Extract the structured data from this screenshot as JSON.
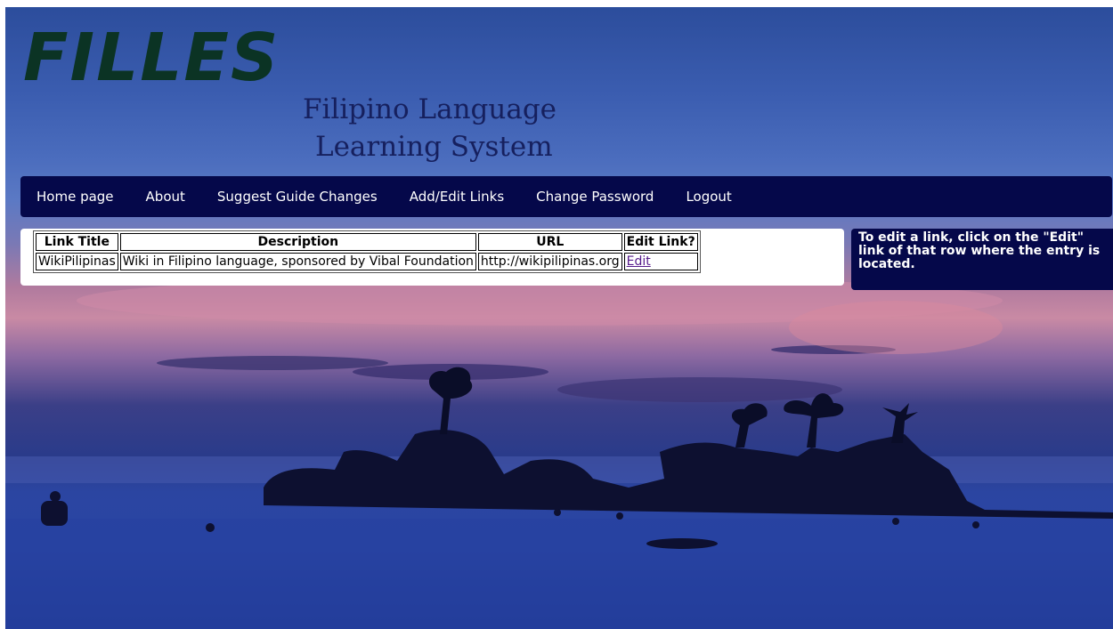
{
  "header": {
    "logo": "FILLES",
    "subtitle_line1": "Filipino Language",
    "subtitle_line2": "Learning System"
  },
  "nav": {
    "items": [
      {
        "label": "Home page"
      },
      {
        "label": "About"
      },
      {
        "label": "Suggest Guide Changes"
      },
      {
        "label": "Add/Edit Links"
      },
      {
        "label": "Change Password"
      },
      {
        "label": "Logout"
      }
    ]
  },
  "links_table": {
    "columns": [
      "Link Title",
      "Description",
      "URL",
      "Edit Link?"
    ],
    "rows": [
      {
        "title": "WikiPilipinas",
        "description": "Wiki in Filipino language, sponsored by Vibal Foundation",
        "url": "http://wikipilipinas.org",
        "edit": "Edit"
      }
    ]
  },
  "sidebar": {
    "info_text": "To edit a link, click on the \"Edit\" link of that row where the entry is located."
  },
  "colors": {
    "nav_bg": "#05084a",
    "logo": "#0b3324",
    "subtitle": "#16205e"
  }
}
